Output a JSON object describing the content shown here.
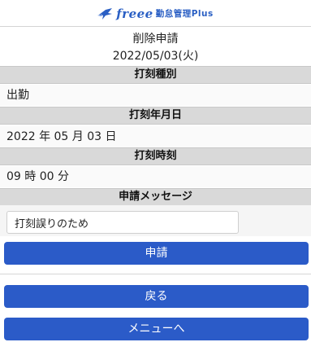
{
  "header": {
    "logo_brand": "freee",
    "logo_product": "勤怠管理Plus"
  },
  "request": {
    "title": "削除申請",
    "date": "2022/05/03(火)"
  },
  "sections": {
    "punch_type": {
      "label": "打刻種別",
      "value": "出勤"
    },
    "punch_date": {
      "label": "打刻年月日",
      "value": "2022 年 05 月 03 日"
    },
    "punch_time": {
      "label": "打刻時刻",
      "value": "09 時 00 分"
    },
    "message": {
      "label": "申請メッセージ",
      "value": "打刻誤りのため"
    }
  },
  "buttons": {
    "submit": "申請",
    "back": "戻る",
    "menu": "メニューへ"
  },
  "colors": {
    "brand": "#2a5fc4",
    "button": "#2b5bc8",
    "section_header_bg": "#d9d9d9"
  }
}
